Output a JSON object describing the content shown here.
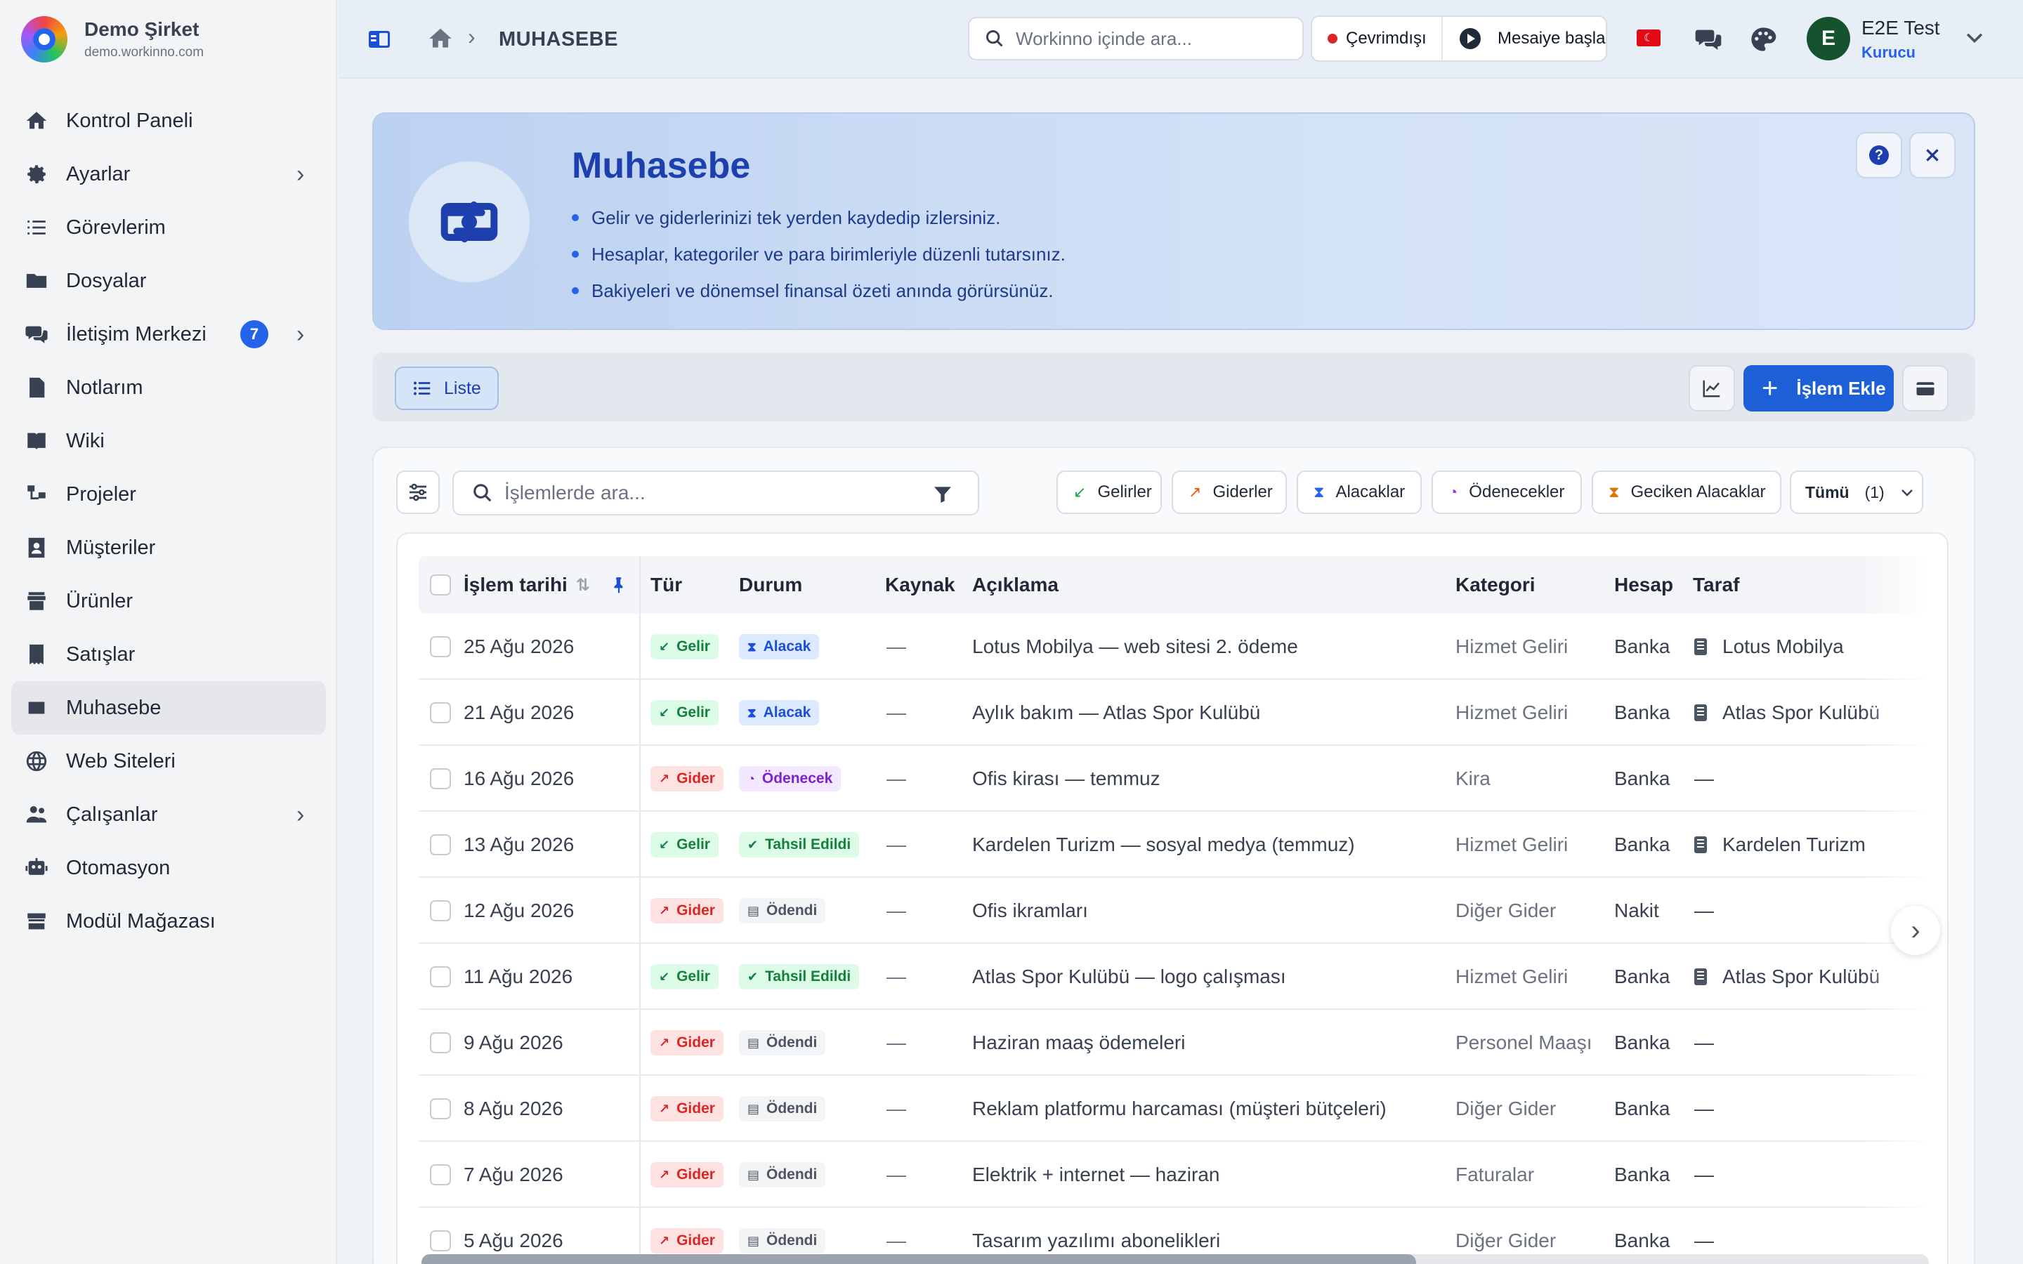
{
  "brand": {
    "name": "Demo Şirket",
    "domain": "demo.workinno.com"
  },
  "sidebar": {
    "items": [
      {
        "label": "Kontrol Paneli",
        "icon": "home-icon"
      },
      {
        "label": "Ayarlar",
        "icon": "gear-icon",
        "chevron": true
      },
      {
        "label": "Görevlerim",
        "icon": "checklist-icon"
      },
      {
        "label": "Dosyalar",
        "icon": "folder-icon"
      },
      {
        "label": "İletişim Merkezi",
        "icon": "chat-icon",
        "badge": "7",
        "chevron": true
      },
      {
        "label": "Notlarım",
        "icon": "note-icon"
      },
      {
        "label": "Wiki",
        "icon": "book-icon"
      },
      {
        "label": "Projeler",
        "icon": "project-icon"
      },
      {
        "label": "Müşteriler",
        "icon": "contact-icon"
      },
      {
        "label": "Ürünler",
        "icon": "box-icon"
      },
      {
        "label": "Satışlar",
        "icon": "receipt-icon"
      },
      {
        "label": "Muhasebe",
        "icon": "accounting-icon",
        "active": true
      },
      {
        "label": "Web Siteleri",
        "icon": "globe-icon"
      },
      {
        "label": "Çalışanlar",
        "icon": "users-icon",
        "chevron": true
      },
      {
        "label": "Otomasyon",
        "icon": "robot-icon"
      },
      {
        "label": "Modül Mağazası",
        "icon": "store-icon"
      }
    ]
  },
  "topbar": {
    "breadcrumb": "MUHASEBE",
    "search_placeholder": "Workinno içinde ara...",
    "offline_label": "Çevrimdışı",
    "shift_label": "Mesaiye başla",
    "user_name": "E2E Test",
    "user_role": "Kurucu",
    "avatar_initial": "E"
  },
  "hero": {
    "title": "Muhasebe",
    "bullets": [
      "Gelir ve giderlerinizi tek yerden kaydedip izlersiniz.",
      "Hesaplar, kategoriler ve para birimleriyle düzenli tutarsınız.",
      "Bakiyeleri ve dönemsel finansal özeti anında görürsünüz."
    ],
    "help_label": "?"
  },
  "toolbar": {
    "list_tab": "Liste",
    "add_button": "İşlem Ekle"
  },
  "filters": {
    "search_placeholder": "İşlemlerde ara...",
    "chips": [
      {
        "label": "Gelirler",
        "icon": "↙",
        "color": "#16a34a"
      },
      {
        "label": "Giderler",
        "icon": "↗",
        "color": "#ea580c"
      },
      {
        "label": "Alacaklar",
        "icon": "⧗",
        "color": "#2563eb"
      },
      {
        "label": "Ödenecekler",
        "icon": "◔",
        "color": "#9333ea"
      },
      {
        "label": "Geciken Alacaklar",
        "icon": "⧗",
        "color": "#d97706"
      }
    ],
    "all_label": "Tümü",
    "all_count": "(1)"
  },
  "table": {
    "headers": {
      "date": "İşlem tarihi",
      "type": "Tür",
      "status": "Durum",
      "source": "Kaynak",
      "description": "Açıklama",
      "category": "Kategori",
      "account": "Hesap",
      "party": "Taraf"
    },
    "rows": [
      {
        "date": "25 Ağu 2026",
        "type": "Gelir",
        "status": "Alacak",
        "source": "—",
        "description": "Lotus Mobilya — web sitesi 2. ödeme",
        "category": "Hizmet Geliri",
        "account": "Banka",
        "party": "Lotus Mobilya"
      },
      {
        "date": "21 Ağu 2026",
        "type": "Gelir",
        "status": "Alacak",
        "source": "—",
        "description": "Aylık bakım — Atlas Spor Kulübü",
        "category": "Hizmet Geliri",
        "account": "Banka",
        "party": "Atlas Spor Kulübü"
      },
      {
        "date": "16 Ağu 2026",
        "type": "Gider",
        "status": "Ödenecek",
        "source": "—",
        "description": "Ofis kirası — temmuz",
        "category": "Kira",
        "account": "Banka",
        "party": "—"
      },
      {
        "date": "13 Ağu 2026",
        "type": "Gelir",
        "status": "Tahsil Edildi",
        "source": "—",
        "description": "Kardelen Turizm — sosyal medya (temmuz)",
        "category": "Hizmet Geliri",
        "account": "Banka",
        "party": "Kardelen Turizm"
      },
      {
        "date": "12 Ağu 2026",
        "type": "Gider",
        "status": "Ödendi",
        "source": "—",
        "description": "Ofis ikramları",
        "category": "Diğer Gider",
        "account": "Nakit",
        "party": "—"
      },
      {
        "date": "11 Ağu 2026",
        "type": "Gelir",
        "status": "Tahsil Edildi",
        "source": "—",
        "description": "Atlas Spor Kulübü — logo çalışması",
        "category": "Hizmet Geliri",
        "account": "Banka",
        "party": "Atlas Spor Kulübü"
      },
      {
        "date": "9 Ağu 2026",
        "type": "Gider",
        "status": "Ödendi",
        "source": "—",
        "description": "Haziran maaş ödemeleri",
        "category": "Personel Maaşı",
        "account": "Banka",
        "party": "—"
      },
      {
        "date": "8 Ağu 2026",
        "type": "Gider",
        "status": "Ödendi",
        "source": "—",
        "description": "Reklam platformu harcaması (müşteri bütçeleri)",
        "category": "Diğer Gider",
        "account": "Banka",
        "party": "—"
      },
      {
        "date": "7 Ağu 2026",
        "type": "Gider",
        "status": "Ödendi",
        "source": "—",
        "description": "Elektrik + internet — haziran",
        "category": "Faturalar",
        "account": "Banka",
        "party": "—"
      },
      {
        "date": "5 Ağu 2026",
        "type": "Gider",
        "status": "Ödendi",
        "source": "—",
        "description": "Tasarım yazılımı abonelikleri",
        "category": "Diğer Gider",
        "account": "Banka",
        "party": "—"
      }
    ]
  },
  "horizontal_scroll_fraction": 0.66
}
